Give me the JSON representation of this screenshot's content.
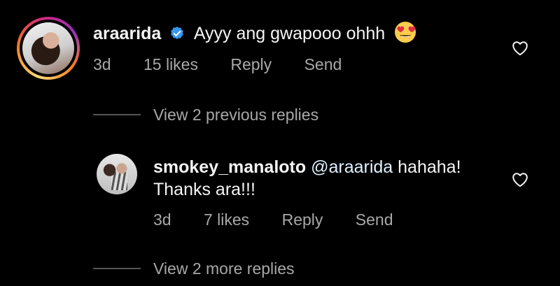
{
  "comments": [
    {
      "username": "araarida",
      "verified": true,
      "text": "Ayyy ang gwapooo ohhh",
      "emoji": "heart-eyes-emoji",
      "age": "3d",
      "likes": "15 likes",
      "reply_label": "Reply",
      "send_label": "Send"
    },
    {
      "username": "smokey_manaloto",
      "mention": "@araarida",
      "text_line1": "hahaha!",
      "text_line2": "Thanks ara!!!",
      "age": "3d",
      "likes": "7 likes",
      "reply_label": "Reply",
      "send_label": "Send"
    }
  ],
  "view_previous_replies": "View 2 previous replies",
  "view_more_replies": "View 2 more replies",
  "colors": {
    "background": "#000000",
    "text_primary": "#f5f5f5",
    "text_secondary": "#a8a8a8",
    "verified_blue": "#3797f0",
    "mention_color": "#e0f1ff"
  }
}
